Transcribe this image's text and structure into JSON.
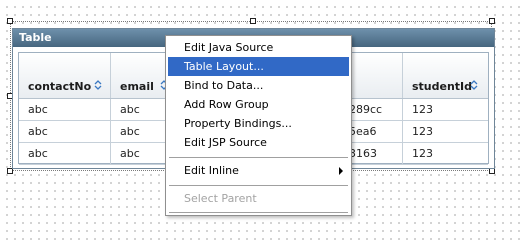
{
  "table": {
    "title": "Table",
    "columns": [
      {
        "label": "contactNo"
      },
      {
        "label": "email"
      },
      {
        "label": ""
      },
      {
        "label": "studentId"
      }
    ],
    "rows": [
      [
        "abc",
        "abc",
        "289cc",
        "123"
      ],
      [
        "abc",
        "abc",
        "5ea6",
        "123"
      ],
      [
        "abc",
        "abc",
        "3163",
        "123"
      ]
    ]
  },
  "context_menu": {
    "items": [
      {
        "label": "Edit Java Source"
      },
      {
        "label": "Table Layout..."
      },
      {
        "label": "Bind to Data..."
      },
      {
        "label": "Add Row Group"
      },
      {
        "label": "Property Bindings..."
      },
      {
        "label": "Edit JSP Source"
      },
      {
        "label": "Edit Inline"
      },
      {
        "label": "Select Parent"
      }
    ],
    "active_item": "Table Layout...",
    "disabled_item": "Select Parent"
  },
  "colors": {
    "title_bar": "#4f6f88",
    "menu_highlight": "#3169c6",
    "sort_icon": "#3a78c2"
  }
}
